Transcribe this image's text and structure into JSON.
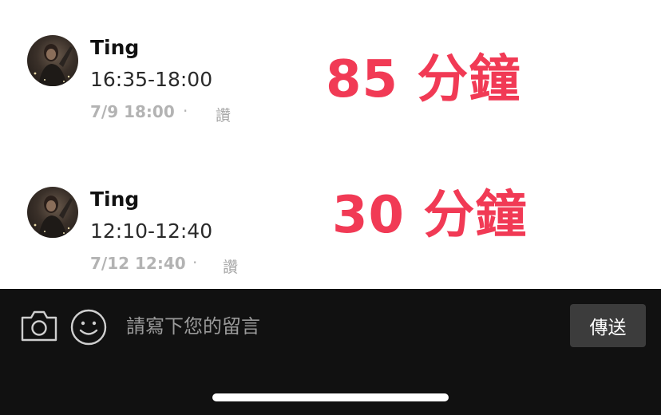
{
  "comments": [
    {
      "author": "Ting",
      "text": "16:35-18:00",
      "timestamp": "7/9 18:00",
      "separator": "·",
      "like_label": "讚",
      "annotation": "85 分鐘"
    },
    {
      "author": "Ting",
      "text": "12:10-12:40",
      "timestamp": "7/12 12:40",
      "separator": "·",
      "like_label": "讚",
      "annotation": "30 分鐘"
    }
  ],
  "composer": {
    "placeholder": "請寫下您的留言",
    "send_label": "傳送",
    "camera_icon": "camera-icon",
    "emoji_icon": "smiley-icon"
  },
  "colors": {
    "annotation": "#f13a55",
    "composer_bg": "#111111",
    "send_button_bg": "#3c3c3c",
    "meta_text": "#b3b3b3"
  }
}
